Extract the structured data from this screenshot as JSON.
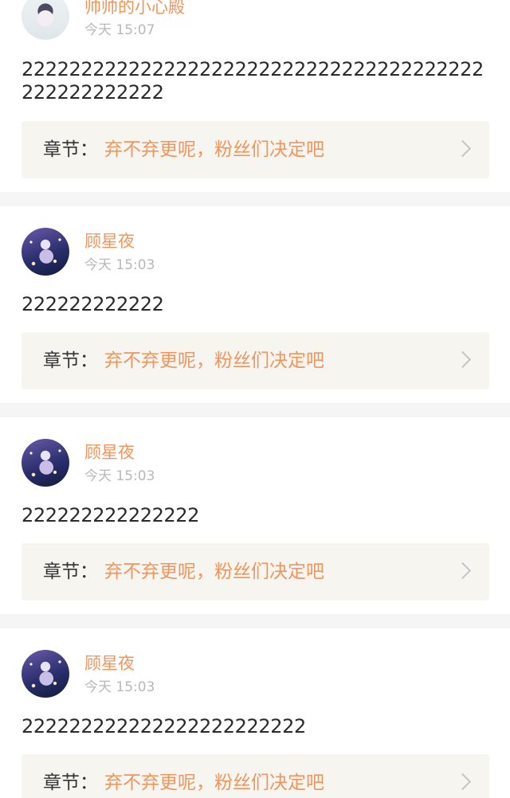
{
  "comments": [
    {
      "username": "帅帅的小心殿",
      "time": "今天 15:07",
      "text": "222222222222222222222222222222222222222222222222222",
      "chapter_label": "章节：",
      "chapter_title": "弃不弃更呢，粉丝们决定吧",
      "avatar_icon": "bunny-girl-avatar"
    },
    {
      "username": "顾星夜",
      "time": "今天 15:03",
      "text": "222222222222",
      "chapter_label": "章节：",
      "chapter_title": "弃不弃更呢，粉丝们决定吧",
      "avatar_icon": "starry-night-anime-avatar"
    },
    {
      "username": "顾星夜",
      "time": "今天 15:03",
      "text": "222222222222222",
      "chapter_label": "章节：",
      "chapter_title": "弃不弃更呢，粉丝们决定吧",
      "avatar_icon": "starry-night-anime-avatar"
    },
    {
      "username": "顾星夜",
      "time": "今天 15:03",
      "text": "222222222222222222222222",
      "chapter_label": "章节：",
      "chapter_title": "弃不弃更呢，粉丝们决定吧",
      "avatar_icon": "starry-night-anime-avatar"
    }
  ],
  "colors": {
    "username": "#f0955c",
    "chapter_title": "#f0955c",
    "timestamp": "#b8b8b8",
    "chapter_box_bg": "#f6f5f0",
    "separator": "#f5f5f5"
  }
}
